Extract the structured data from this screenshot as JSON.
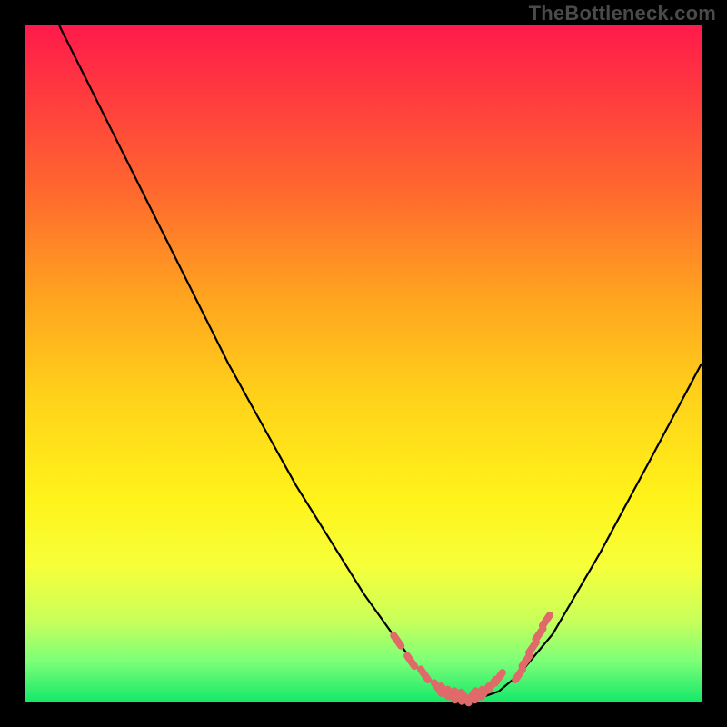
{
  "watermark": "TheBottleneck.com",
  "chart_data": {
    "type": "line",
    "title": "",
    "xlabel": "",
    "ylabel": "",
    "xlim": [
      0,
      100
    ],
    "ylim": [
      0,
      100
    ],
    "series": [
      {
        "name": "bottleneck-curve",
        "x": [
          5,
          10,
          15,
          20,
          25,
          30,
          35,
          40,
          45,
          50,
          55,
          58,
          60,
          62,
          64,
          66,
          68,
          70,
          73,
          78,
          85,
          92,
          100
        ],
        "y": [
          100,
          90,
          80,
          70,
          60,
          50,
          41,
          32,
          24,
          16,
          9,
          5,
          3,
          1.5,
          0.8,
          0.6,
          0.8,
          1.5,
          4,
          10,
          22,
          35,
          50
        ]
      }
    ],
    "markers": {
      "name": "highlighted-points",
      "color": "#e06a6a",
      "x": [
        55,
        57,
        59,
        61,
        62,
        63,
        64,
        65,
        66,
        67,
        68,
        69,
        70,
        73,
        74,
        75,
        76,
        77
      ],
      "y": [
        9,
        6,
        4,
        2,
        1.5,
        1,
        0.8,
        0.6,
        0.8,
        1,
        1.5,
        2.5,
        3.5,
        4,
        6,
        8,
        10,
        12
      ]
    },
    "background_gradient": {
      "top": "#ff1a4b",
      "bottom": "#16e86a"
    }
  }
}
